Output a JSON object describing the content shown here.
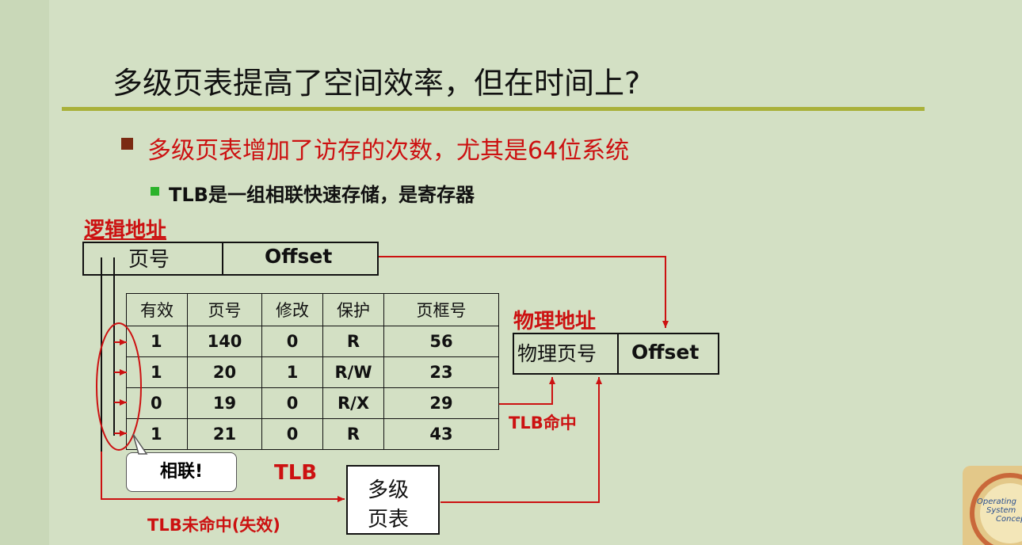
{
  "title": "多级页表提高了空间效率，但在时间上?",
  "bullet1": "多级页表增加了访存的次数，尤其是64位系统",
  "bullet2": "TLB是一组相联快速存储，是寄存器",
  "logical_address": {
    "label": "逻辑地址",
    "page_field": "页号",
    "offset_field": "Offset"
  },
  "tlb_table": {
    "headers": [
      "有效",
      "页号",
      "修改",
      "保护",
      "页框号"
    ],
    "rows": [
      [
        "1",
        "140",
        "0",
        "R",
        "56"
      ],
      [
        "1",
        "20",
        "1",
        "R/W",
        "23"
      ],
      [
        "0",
        "19",
        "0",
        "R/X",
        "29"
      ],
      [
        "1",
        "21",
        "0",
        "R",
        "43"
      ]
    ],
    "caption": "TLB"
  },
  "associative_callout": "相联!",
  "physical_address": {
    "label": "物理地址",
    "frame_field": "物理页号",
    "offset_field": "Offset"
  },
  "tlb_hit": "TLB命中",
  "tlb_miss": "TLB未命中(失效)",
  "multilevel_page_table": [
    "多级",
    "页表"
  ],
  "book_cover": {
    "line1": "Operating",
    "line2": "System",
    "line3": "Concep"
  },
  "colors": {
    "background": "#d3e0c4",
    "accent_red": "#cc1111",
    "rule": "#a9b13a"
  }
}
